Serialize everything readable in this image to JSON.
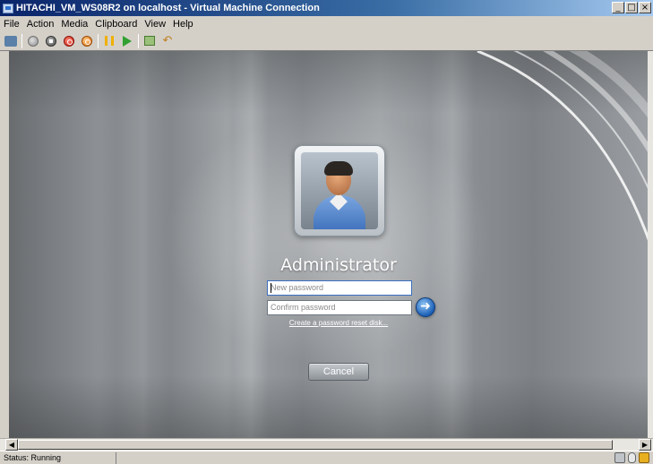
{
  "window": {
    "title": "HITACHI_VM_WS08R2 on localhost - Virtual Machine Connection",
    "minimize": "_",
    "maximize": "□",
    "close": "×"
  },
  "menu": [
    "File",
    "Action",
    "Media",
    "Clipboard",
    "View",
    "Help"
  ],
  "toolbar": {
    "icons": [
      "ctrl-alt-del-icon",
      "start-icon",
      "turn-off-icon",
      "shut-down-icon",
      "save-icon",
      "pause-icon",
      "reset-icon",
      "snapshot-icon",
      "revert-icon"
    ]
  },
  "logon": {
    "username": "Administrator",
    "new_password_placeholder": "New password",
    "confirm_password_placeholder": "Confirm password",
    "go_arrow": "➜",
    "reset_link": "Create a password reset disk...",
    "cancel_label": "Cancel"
  },
  "scroll": {
    "left_arrow": "◀",
    "right_arrow": "▶"
  },
  "status": {
    "text": "Status: Running"
  }
}
